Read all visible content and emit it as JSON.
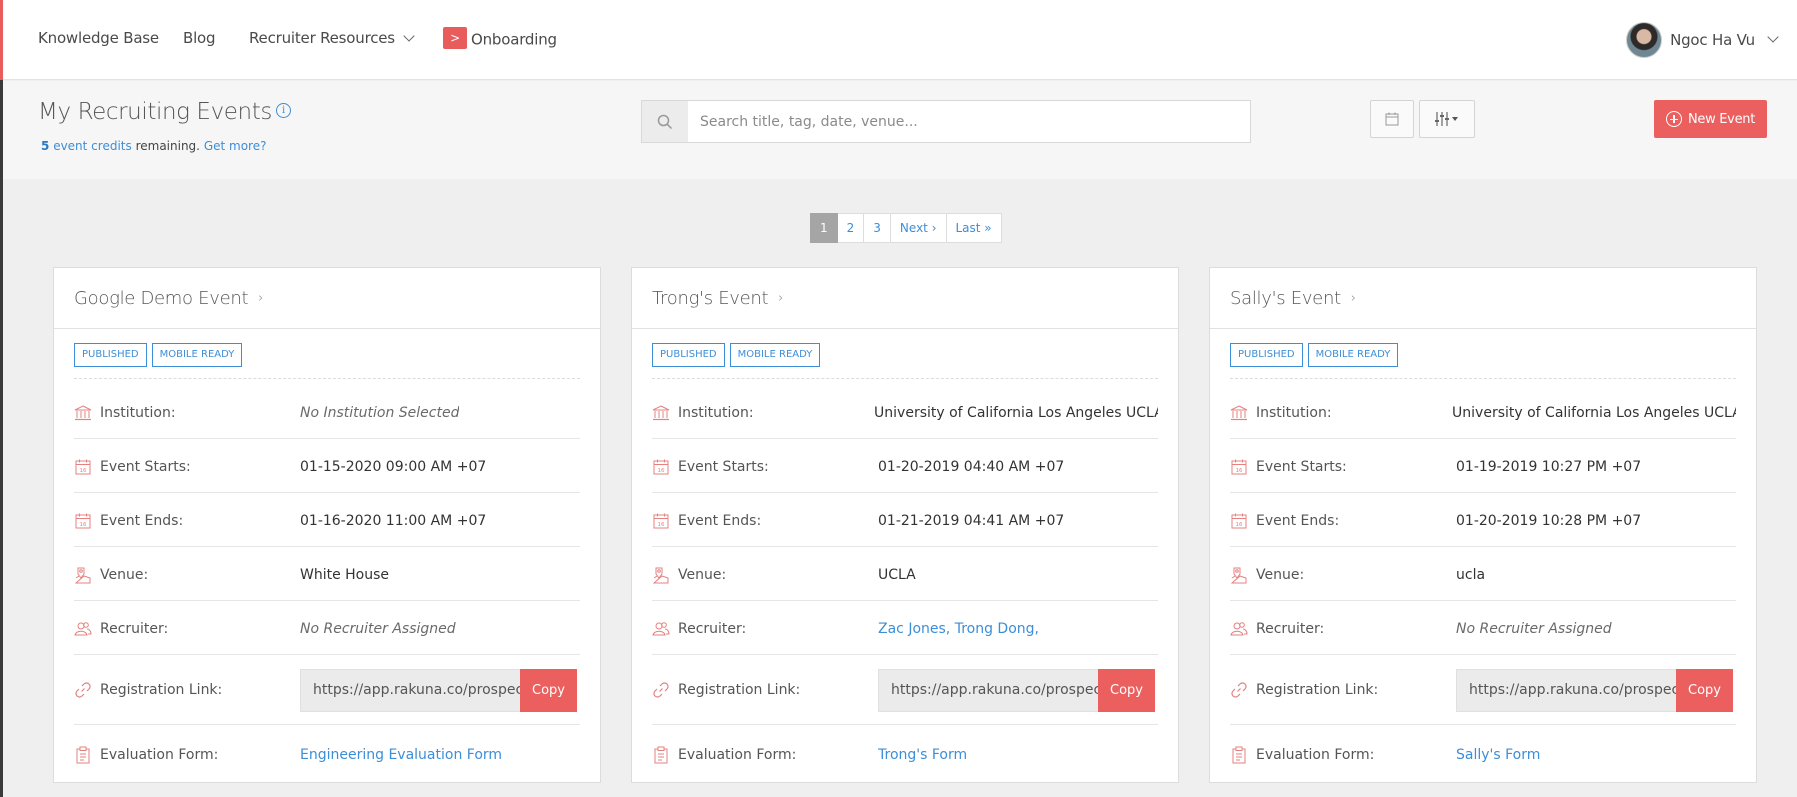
{
  "nav": {
    "knowledge_base": "Knowledge Base",
    "blog": "Blog",
    "recruiter_resources": "Recruiter Resources",
    "onboarding_badge": ">",
    "onboarding": "Onboarding",
    "user_name": "Ngoc Ha Vu"
  },
  "header": {
    "title": "My Recruiting Events",
    "info_glyph": "i",
    "credits_count": "5",
    "credits_link": "event credits",
    "credits_text": "remaining.",
    "get_more": "Get more?",
    "search_placeholder": "Search title, tag, date, venue...",
    "new_event": "New Event"
  },
  "pagination": [
    "1",
    "2",
    "3",
    "Next ›",
    "Last »"
  ],
  "labels": {
    "institution": "Institution:",
    "event_starts": "Event Starts:",
    "event_ends": "Event Ends:",
    "venue": "Venue:",
    "recruiter": "Recruiter:",
    "registration_link": "Registration Link:",
    "evaluation_form": "Evaluation Form:",
    "copy": "Copy",
    "badge_published": "PUBLISHED",
    "badge_mobile": "MOBILE READY",
    "title_arrow": "›"
  },
  "events": [
    {
      "title": "Google Demo Event",
      "institution": "No Institution Selected",
      "starts": "01-15-2020 09:00 AM +07",
      "ends": "01-16-2020 11:00 AM +07",
      "venue": "White House",
      "recruiter_empty": "No Recruiter Assigned",
      "registration_link": "https://app.rakuna.co/prospect",
      "evaluation_form": "Engineering Evaluation Form"
    },
    {
      "title": "Trong's Event",
      "institution": "University of California Los Angeles UCLA",
      "starts": "01-20-2019 04:40 AM +07",
      "ends": "01-21-2019 04:41 AM +07",
      "venue": "UCLA",
      "recruiter_1": "Zac Jones",
      "recruiter_sep": ", ",
      "recruiter_2": "Trong Dong",
      "recruiter_trail": ",",
      "registration_link": "https://app.rakuna.co/prospect",
      "evaluation_form": "Trong's Form"
    },
    {
      "title": "Sally's Event",
      "institution": "University of California Los Angeles UCLA",
      "starts": "01-19-2019 10:27 PM +07",
      "ends": "01-20-2019 10:28 PM +07",
      "venue": "ucla",
      "recruiter_empty": "No Recruiter Assigned",
      "registration_link": "https://app.rakuna.co/prospect",
      "evaluation_form": "Sally's Form"
    }
  ],
  "colors": {
    "accent": "#eb5f5f",
    "link": "#3d8ed8",
    "icon": "#e5807f"
  },
  "icons": {
    "search": "search-icon",
    "calendar": "calendar-icon",
    "filter": "filter-sliders-icon",
    "institution": "institution-building-icon",
    "venue": "map-pin-icon",
    "recruiter": "users-icon",
    "link": "link-icon",
    "form": "clipboard-icon"
  }
}
